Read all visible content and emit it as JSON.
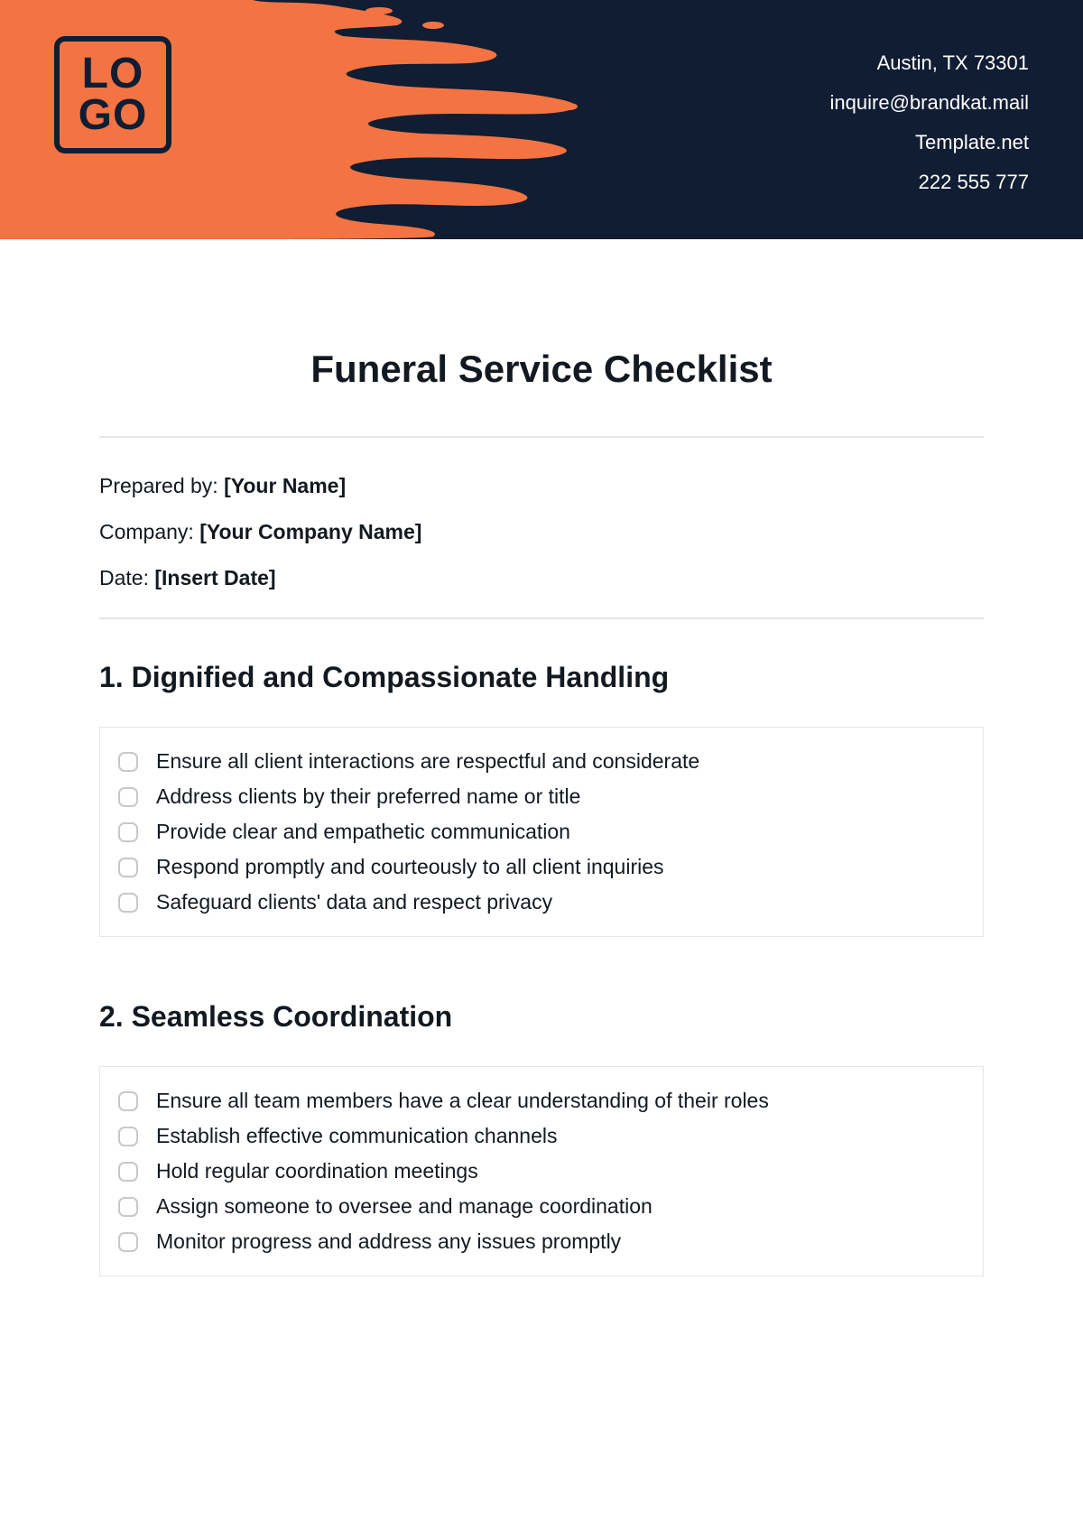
{
  "header": {
    "logo_line1": "LO",
    "logo_line2": "GO",
    "contact": {
      "address": "Austin, TX 73301",
      "email": "inquire@brandkat.mail",
      "website": "Template.net",
      "phone": "222 555 777"
    }
  },
  "title": "Funeral Service Checklist",
  "meta": {
    "prepared_by_label": "Prepared by: ",
    "prepared_by_value": "[Your Name]",
    "company_label": "Company: ",
    "company_value": "[Your Company Name]",
    "date_label": "Date: ",
    "date_value": "[Insert Date]"
  },
  "sections": [
    {
      "heading": "1. Dignified and Compassionate Handling",
      "items": [
        "Ensure all client interactions are respectful and considerate",
        "Address clients by their preferred name or title",
        "Provide clear and empathetic communication",
        "Respond promptly and courteously to all client inquiries",
        "Safeguard clients' data and respect privacy"
      ]
    },
    {
      "heading": "2. Seamless Coordination",
      "items": [
        "Ensure all team members have a clear understanding of their roles",
        "Establish effective communication channels",
        "Hold regular coordination meetings",
        "Assign someone to oversee and manage coordination",
        "Monitor progress and address any issues promptly"
      ]
    }
  ]
}
